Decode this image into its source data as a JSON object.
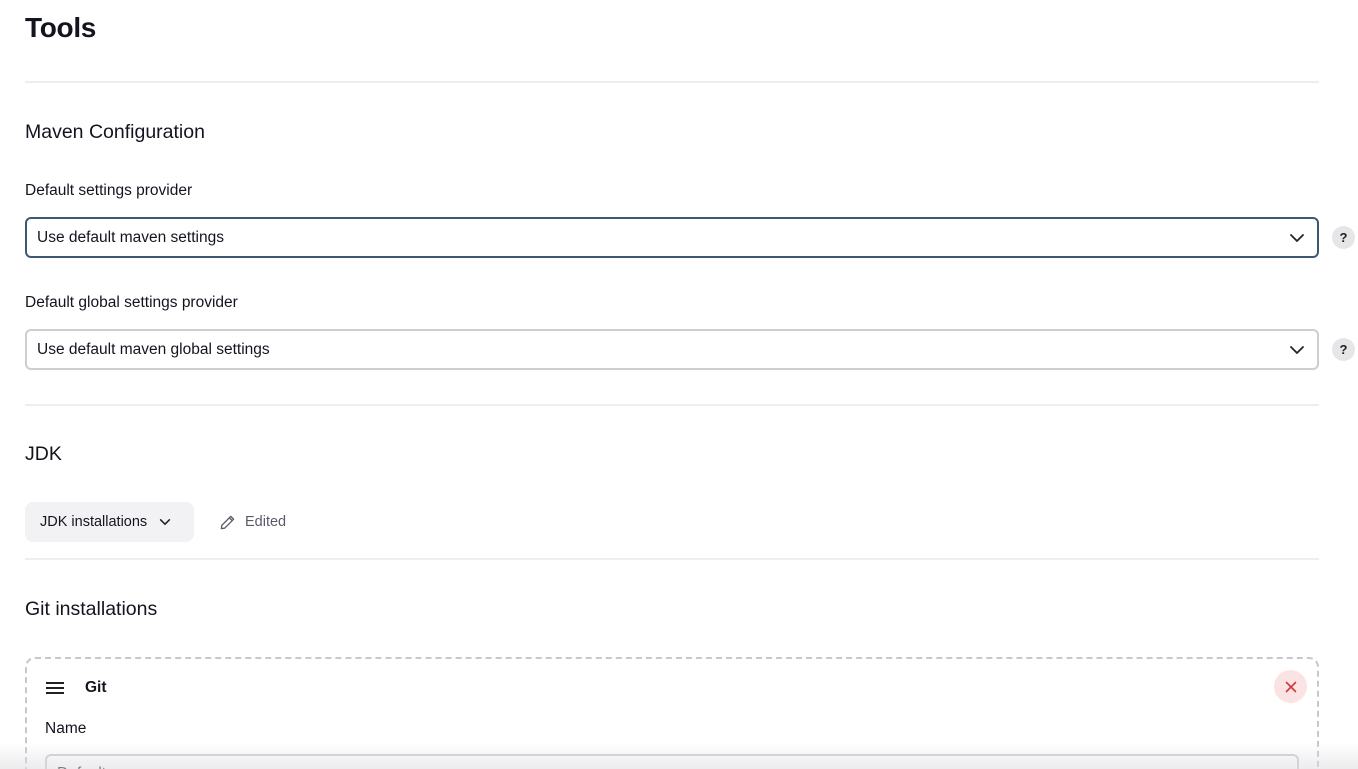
{
  "page": {
    "title": "Tools"
  },
  "maven": {
    "title": "Maven Configuration",
    "settings_label": "Default settings provider",
    "settings_value": "Use default maven settings",
    "global_label": "Default global settings provider",
    "global_value": "Use default maven global settings",
    "help_symbol": "?"
  },
  "jdk": {
    "title": "JDK",
    "installations_button": "JDK installations",
    "edited_label": "Edited"
  },
  "git": {
    "title": "Git installations",
    "card_title": "Git",
    "name_label": "Name",
    "name_value": "Default"
  },
  "icons": {
    "chevron": "chevron-down-icon",
    "help": "help-icon",
    "edit": "pencil-icon",
    "drag": "drag-handle-icon",
    "close": "close-icon"
  },
  "colors": {
    "focus_border": "#3f5675",
    "close_bg": "#fbe3e4",
    "close_icon": "#d03a3a"
  }
}
